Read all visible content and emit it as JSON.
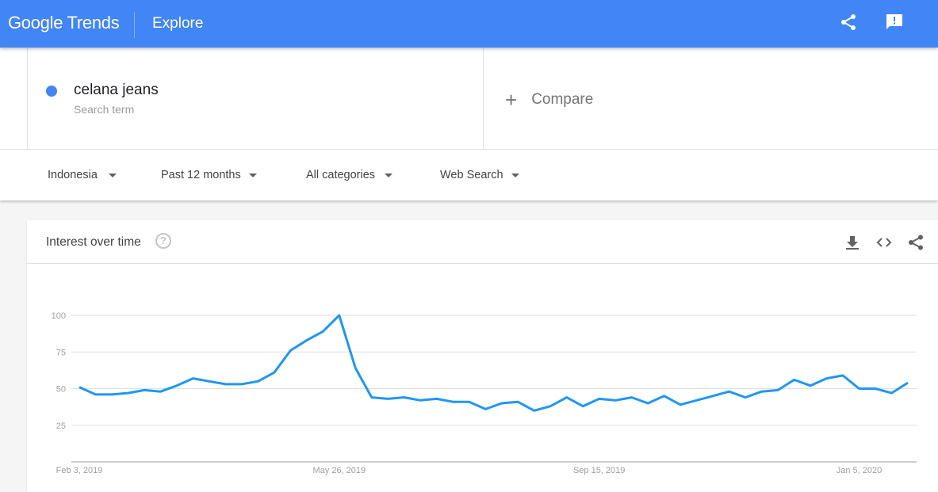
{
  "header": {
    "logo": "Google Trends",
    "section": "Explore",
    "share_icon": "share-icon",
    "feedback_icon": "feedback-icon",
    "color": "#4285f4"
  },
  "search": {
    "term": "celana jeans",
    "term_type": "Search term",
    "term_color": "#4285f4",
    "compare_label": "Compare"
  },
  "filters": [
    {
      "label": "Indonesia"
    },
    {
      "label": "Past 12 months"
    },
    {
      "label": "All categories"
    },
    {
      "label": "Web Search"
    }
  ],
  "card": {
    "title": "Interest over time",
    "help_icon": "?",
    "actions": [
      "download-icon",
      "embed-icon",
      "share-icon"
    ]
  },
  "chart_data": {
    "type": "line",
    "title": "Interest over time",
    "xlabel": "",
    "ylabel": "",
    "ylim": [
      0,
      100
    ],
    "yticks": [
      25,
      50,
      75,
      100
    ],
    "grid": true,
    "x_tick_labels": [
      {
        "label": "Feb 3, 2019",
        "index": 0
      },
      {
        "label": "May 26, 2019",
        "index": 16
      },
      {
        "label": "Sep 15, 2019",
        "index": 32
      },
      {
        "label": "Jan 5, 2020",
        "index": 48
      }
    ],
    "series": [
      {
        "name": "celana jeans",
        "color": "#2196f3",
        "values": [
          51,
          46,
          46,
          47,
          49,
          48,
          52,
          57,
          55,
          53,
          53,
          55,
          61,
          76,
          83,
          89,
          100,
          64,
          44,
          43,
          44,
          42,
          43,
          41,
          41,
          36,
          40,
          41,
          35,
          38,
          44,
          38,
          43,
          42,
          44,
          40,
          45,
          39,
          42,
          45,
          48,
          44,
          48,
          49,
          56,
          52,
          57,
          59,
          50,
          50,
          47,
          54
        ]
      }
    ]
  }
}
